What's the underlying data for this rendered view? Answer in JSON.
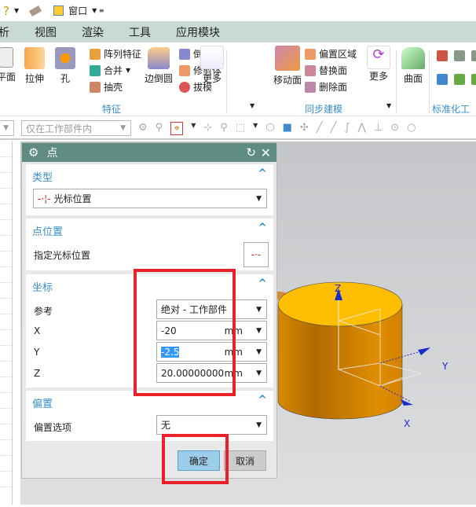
{
  "quick_access": {
    "window_label": "窗口"
  },
  "menu": [
    "析",
    "视图",
    "渲染",
    "工具",
    "应用模块"
  ],
  "ribbon": {
    "big": [
      "平面",
      "拉伸",
      "孔",
      "边倒圆",
      "更多",
      "移动面",
      "更多",
      "曲面"
    ],
    "small": [
      "阵列特征",
      "合并",
      "抽壳",
      "倒斜角",
      "修剪体",
      "拔模",
      "偏置区域",
      "替换面",
      "删除面"
    ],
    "groups": [
      "特征",
      "同步建模",
      "标准化工具"
    ]
  },
  "toolbar": {
    "filter_placeholder": "仅在工作部件内"
  },
  "dialog": {
    "title": "点",
    "type_section": {
      "header": "类型",
      "value": "光标位置"
    },
    "location_section": {
      "header": "点位置",
      "label": "指定光标位置"
    },
    "coord_section": {
      "header": "坐标",
      "reference_label": "参考",
      "reference_value": "绝对 - 工作部件",
      "fields": [
        {
          "label": "X",
          "value": "-20",
          "unit": "mm"
        },
        {
          "label": "Y",
          "value": "-2.5",
          "unit": "mm"
        },
        {
          "label": "Z",
          "value": "20.00000000(",
          "unit": "mm"
        }
      ]
    },
    "offset_section": {
      "header": "偏置",
      "label": "偏置选项",
      "value": "无"
    },
    "ok": "确定",
    "cancel": "取消"
  },
  "viewport": {
    "axes": [
      "Z",
      "Y",
      "X"
    ]
  },
  "colors": {
    "accent": "#3a8ec8",
    "title_bar": "#5e8c82",
    "highlight": "#e8212a",
    "cylinder_top": "#ffbf00",
    "cylinder_side": "#d98a00"
  }
}
